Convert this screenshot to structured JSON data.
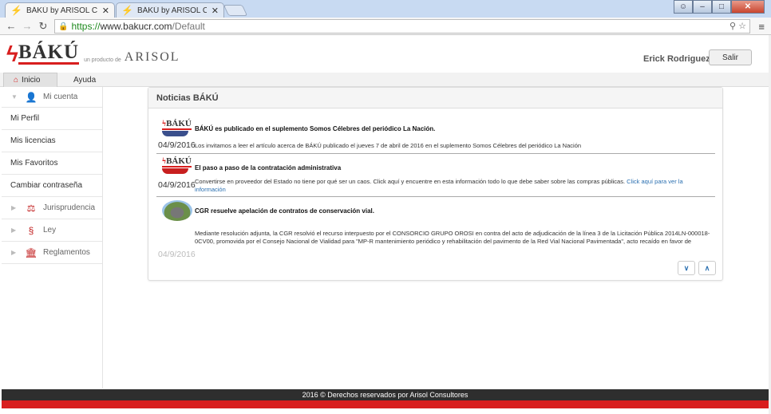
{
  "browser": {
    "tabs": [
      {
        "title": "BÁKÚ by ARISOL Consultor",
        "active": true
      },
      {
        "title": "BÁKÚ by ARISOL Consulto",
        "active": false
      }
    ],
    "url_scheme": "https://",
    "url_host": "www.bakucr.com",
    "url_path": "/Default",
    "icons": {
      "back": "arrow-left-icon",
      "forward": "arrow-right-icon",
      "reload": "reload-icon",
      "lock": "lock-icon",
      "zoom": "magnifier-icon",
      "star": "star-icon",
      "menu": "hamburger-icon"
    }
  },
  "header": {
    "logo_text": "BÁKÚ",
    "logo_tagline": "un producto de",
    "brand": "ARISOL",
    "user_name": "Erick Rodriguez",
    "logout_label": "Salir",
    "accent": "#d81e1e"
  },
  "nav": {
    "tabs": [
      {
        "label": "Inicio",
        "icon": "home-icon",
        "active": true
      },
      {
        "label": "Ayuda",
        "active": false
      }
    ]
  },
  "sidebar": {
    "account_group": "Mi cuenta",
    "links": [
      "Mi Perfil",
      "Mis licencias",
      "Mis Favoritos",
      "Cambiar contraseña"
    ],
    "groups": [
      {
        "label": "Jurisprudencia",
        "icon": "gavel-icon"
      },
      {
        "label": "Ley",
        "icon": "law-icon"
      },
      {
        "label": "Reglamentos",
        "icon": "building-icon"
      }
    ]
  },
  "news": {
    "title": "Noticias BÁKÚ",
    "items": [
      {
        "date": "04/9/2016",
        "title": "BÁKÚ es publicado en el suplemento Somos Célebres del periódico La Nación.",
        "body": "Los invitamos a leer el artículo acerca de BÁKÚ publicado el jueves 7 de abril de 2016 en el suplemento Somos Célebres del periódico La Nación",
        "link": ""
      },
      {
        "date": "04/9/2016",
        "title": "El paso a paso de la contratación administrativa",
        "body": "Convertirse en proveedor del Estado no tiene por qué ser un caos. Click aquí y encuentre en esta información todo lo que debe saber sobre las compras públicas.",
        "link": "Click aquí para ver la información"
      },
      {
        "date": "04/9/2016",
        "title": "CGR resuelve apelación de contratos de conservación vial.",
        "body": "Mediante resolución adjunta, la CGR resolvió el recurso interpuesto por el CONSORCIO GRUPO OROSI en contra del acto de adjudicación de la línea 3 de la Licitación Pública 2014LN-000018-0CV00, promovida por el Consejo Nacional de Vialidad para \"MP-R mantenimiento periódico y rehabilitación del pavimento de la Red Vial Nacional Pavimentada\", acto recaído en favor de",
        "link": ""
      }
    ],
    "controls": {
      "down_icon": "chevron-down-icon",
      "up_icon": "chevron-up-icon"
    }
  },
  "footer": {
    "text": "2016 © Derechos reservados por Arisol Consultores"
  }
}
